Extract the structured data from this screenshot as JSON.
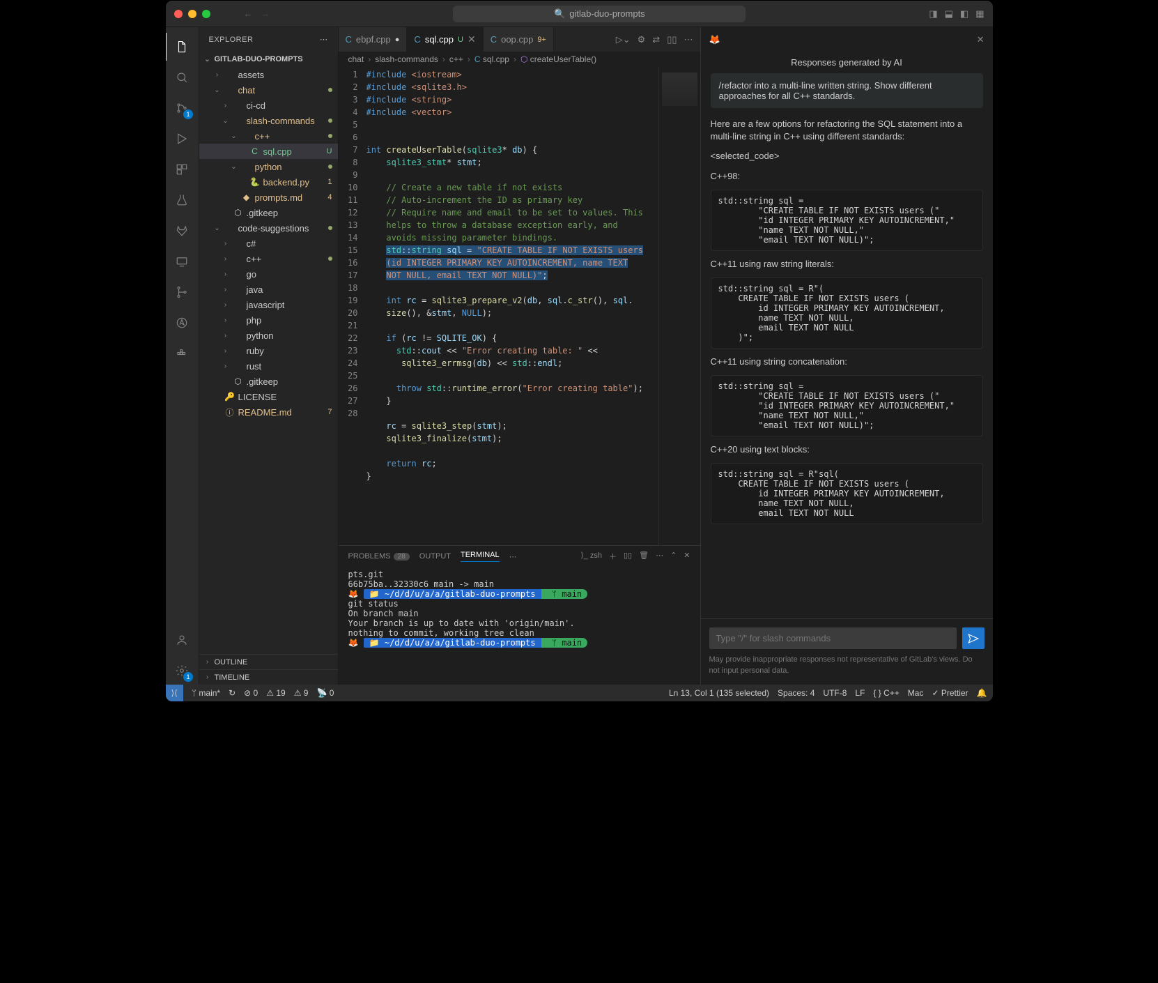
{
  "title": "gitlab-duo-prompts",
  "activity": {
    "scm_badge": "1",
    "settings_badge": "1"
  },
  "sidebar": {
    "title": "EXPLORER",
    "root": "GITLAB-DUO-PROMPTS",
    "outline": "OUTLINE",
    "timeline": "TIMELINE",
    "tree": [
      {
        "indent": 1,
        "chev": "›",
        "icon": "",
        "label": "assets"
      },
      {
        "indent": 1,
        "chev": "⌄",
        "icon": "",
        "label": "chat",
        "cls": "orange",
        "dot": true
      },
      {
        "indent": 2,
        "chev": "›",
        "icon": "",
        "label": "ci-cd"
      },
      {
        "indent": 2,
        "chev": "⌄",
        "icon": "",
        "label": "slash-commands",
        "cls": "orange",
        "dot": true
      },
      {
        "indent": 3,
        "chev": "⌄",
        "icon": "",
        "label": "c++",
        "cls": "orange",
        "dot": true
      },
      {
        "indent": 4,
        "chev": "",
        "icon": "C",
        "label": "sql.cpp",
        "cls": "green selected",
        "badge": "U"
      },
      {
        "indent": 3,
        "chev": "⌄",
        "icon": "",
        "label": "python",
        "cls": "orange",
        "dot": true
      },
      {
        "indent": 4,
        "chev": "",
        "icon": "🐍",
        "label": "backend.py",
        "cls": "orange",
        "badge": "1"
      },
      {
        "indent": 3,
        "chev": "",
        "icon": "◆",
        "label": "prompts.md",
        "cls": "orange",
        "badge": "4"
      },
      {
        "indent": 2,
        "chev": "",
        "icon": "⬡",
        "label": ".gitkeep"
      },
      {
        "indent": 1,
        "chev": "⌄",
        "icon": "",
        "label": "code-suggestions",
        "dot": true
      },
      {
        "indent": 2,
        "chev": "›",
        "icon": "",
        "label": "c#"
      },
      {
        "indent": 2,
        "chev": "›",
        "icon": "",
        "label": "c++",
        "dot": true
      },
      {
        "indent": 2,
        "chev": "›",
        "icon": "",
        "label": "go"
      },
      {
        "indent": 2,
        "chev": "›",
        "icon": "",
        "label": "java"
      },
      {
        "indent": 2,
        "chev": "›",
        "icon": "",
        "label": "javascript"
      },
      {
        "indent": 2,
        "chev": "›",
        "icon": "",
        "label": "php"
      },
      {
        "indent": 2,
        "chev": "›",
        "icon": "",
        "label": "python"
      },
      {
        "indent": 2,
        "chev": "›",
        "icon": "",
        "label": "ruby"
      },
      {
        "indent": 2,
        "chev": "›",
        "icon": "",
        "label": "rust"
      },
      {
        "indent": 2,
        "chev": "",
        "icon": "⬡",
        "label": ".gitkeep"
      },
      {
        "indent": 1,
        "chev": "",
        "icon": "🔑",
        "label": "LICENSE"
      },
      {
        "indent": 1,
        "chev": "",
        "icon": "ⓘ",
        "label": "README.md",
        "cls": "orange",
        "badge": "7"
      }
    ]
  },
  "tabs": [
    {
      "icon": "C",
      "label": "ebpf.cpp",
      "mod": "●",
      "active": false
    },
    {
      "icon": "C",
      "label": "sql.cpp",
      "mod": "U",
      "close": true,
      "active": true
    },
    {
      "icon": "C",
      "label": "oop.cpp",
      "mod": "9+",
      "active": false
    }
  ],
  "breadcrumb": [
    "chat",
    "slash-commands",
    "c++",
    "sql.cpp",
    "createUserTable()"
  ],
  "panel": {
    "tabs": {
      "problems": "PROBLEMS",
      "problems_count": "28",
      "output": "OUTPUT",
      "terminal": "TERMINAL"
    },
    "shell": "zsh",
    "terminal_lines": [
      "pts.git",
      "   66b75ba..32330c6  main -> main",
      "PROMPT ~/d/d/u/a/a/gitlab-duo-prompts  main",
      "   git status",
      "On branch main",
      "Your branch is up to date with 'origin/main'.",
      "",
      "nothing to commit, working tree clean",
      "PROMPT ~/d/d/u/a/a/gitlab-duo-prompts  main"
    ]
  },
  "ai": {
    "title": "Responses generated by AI",
    "note": "/refactor into a multi-line written string. Show different approaches for all C++ standards.",
    "intro": "Here are a few options for refactoring the SQL statement into a multi-line string in C++ using different standards:",
    "selected_tag": "<selected_code>",
    "sections": [
      {
        "title": "C++98:",
        "code": "std::string sql =\n        \"CREATE TABLE IF NOT EXISTS users (\"\n        \"id INTEGER PRIMARY KEY AUTOINCREMENT,\"\n        \"name TEXT NOT NULL,\"\n        \"email TEXT NOT NULL)\";"
      },
      {
        "title": "C++11 using raw string literals:",
        "code": "std::string sql = R\"(\n    CREATE TABLE IF NOT EXISTS users (\n        id INTEGER PRIMARY KEY AUTOINCREMENT,\n        name TEXT NOT NULL,\n        email TEXT NOT NULL\n    )\";"
      },
      {
        "title": "C++11 using string concatenation:",
        "code": "std::string sql =\n        \"CREATE TABLE IF NOT EXISTS users (\"\n        \"id INTEGER PRIMARY KEY AUTOINCREMENT,\"\n        \"name TEXT NOT NULL,\"\n        \"email TEXT NOT NULL)\";"
      },
      {
        "title": "C++20 using text blocks:",
        "code": "std::string sql = R\"sql(\n    CREATE TABLE IF NOT EXISTS users (\n        id INTEGER PRIMARY KEY AUTOINCREMENT,\n        name TEXT NOT NULL,\n        email TEXT NOT NULL"
      }
    ],
    "placeholder": "Type \"/\" for slash commands",
    "disclaimer": "May provide inappropriate responses not representative of GitLab's views. Do not input personal data."
  },
  "status": {
    "branch": "main*",
    "sync": "↻",
    "errors": "⊘ 0",
    "warnings": "⚠ 19",
    "other": "⚠ 9",
    "ports": "📡 0",
    "cursor": "Ln 13, Col 1 (135 selected)",
    "spaces": "Spaces: 4",
    "encoding": "UTF-8",
    "eol": "LF",
    "lang": "{ }  C++",
    "os": "Mac",
    "formatter": "✓ Prettier"
  },
  "code": {
    "line_numbers": [
      1,
      2,
      3,
      4,
      5,
      6,
      7,
      8,
      9,
      10,
      11,
      12,
      "",
      13,
      "",
      14,
      15,
      "",
      16,
      17,
      18,
      "",
      19,
      20,
      21,
      22,
      23,
      24,
      25,
      26,
      27,
      28
    ]
  }
}
